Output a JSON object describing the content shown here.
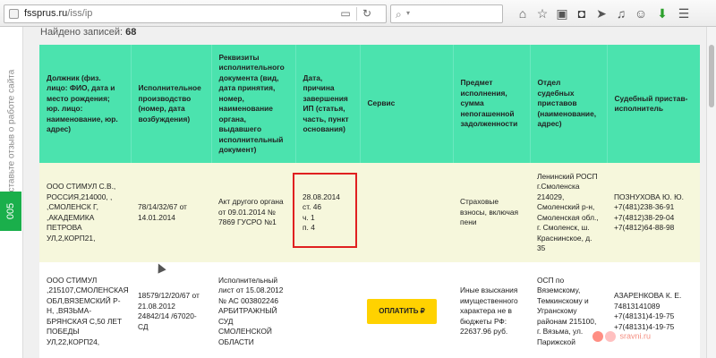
{
  "browser": {
    "url_host": "fssprus.ru",
    "url_path": "/iss/ip",
    "search_placeholder": "",
    "icons": [
      "home-icon",
      "star-icon",
      "clipboard-icon",
      "pocket-icon",
      "send-icon",
      "bell-icon",
      "user-icon",
      "download-icon",
      "menu-icon"
    ]
  },
  "sidebar": {
    "feedback_label": "Оставьте отзыв о работе сайта",
    "green_tab_label": "005"
  },
  "results": {
    "found_label": "Найдено записей:",
    "found_count": "68"
  },
  "table": {
    "headers": [
      "Должник (физ. лицо: ФИО, дата и место рождения; юр. лицо: наименование, юр. адрес)",
      "Исполнительное производство (номер, дата возбуждения)",
      "Реквизиты исполнительного документа (вид, дата принятия, номер, наименование органа, выдавшего исполнительный документ)",
      "Дата, причина завершения ИП (статья, часть, пункт основания)",
      "Сервис",
      "Предмет исполнения, сумма непогашенной задолженности",
      "Отдел судебных приставов (наименование, адрес)",
      "Судебный пристав-исполнитель"
    ],
    "rows": [
      {
        "debtor": "ООО СТИМУЛ С.В., РОССИЯ,214000, , ,СМОЛЕНСК Г, ,АКАДЕМИКА ПЕТРОВА УЛ,2,КОРП21,",
        "proceeding": "78/14/32/67 от 14.01.2014",
        "document": "Акт другого органа от 09.01.2014 № 7869 ГУСРО №1",
        "completion": [
          "28.08.2014",
          "ст. 46",
          "ч. 1",
          "п. 4"
        ],
        "service": "",
        "subject": "Страховые взносы, включая пени",
        "department": "Ленинский РОСП г.Смоленска 214029, Смоленский р-н, Смоленская обл., г. Смоленск, ш. Краснинское, д. 35",
        "bailiff": [
          "ПОЗНУХОВА Ю. Ю.",
          "+7(481)238-36-91",
          "+7(4812)38-29-04",
          "+7(4812)64-88-98"
        ]
      },
      {
        "debtor": "ООО СТИМУЛ ,215107,СМОЛЕНСКАЯ ОБЛ,ВЯЗЕМСКИЙ Р-Н, ,ВЯЗЬМА-БРЯНСКАЯ С,50 ЛЕТ ПОБЕДЫ УЛ,22,КОРП24,",
        "proceeding": "18579/12/20/67 от 21.08.2012 24842/14 /67020-СД",
        "document": "Исполнительный лист от 15.08.2012 № АС 003802246 АРБИТРАЖНЫЙ СУД СМОЛЕНСКОЙ ОБЛАСТИ",
        "completion": [],
        "service": "ОПЛАТИТЬ ₽",
        "subject": "Иные взыскания имущественного характера не в бюджеты РФ: 22637.96 руб.",
        "department": "ОСП по Вяземскому, Темкинскому и Угранскому районам 215100, г. Вязьма, ул. Парижской",
        "bailiff": [
          "АЗАРЕНКОВА К. Е.",
          "74813141089",
          "+7(48131)4-19-75",
          "+7(48131)4-19-75"
        ]
      }
    ]
  },
  "watermark": "sravni.ru",
  "colors": {
    "header_bg": "#4be3ae",
    "row1_bg": "#f6f7dc",
    "pay_button": "#ffd200",
    "highlight": "#e02020",
    "green_tab": "#1aaf4b"
  }
}
